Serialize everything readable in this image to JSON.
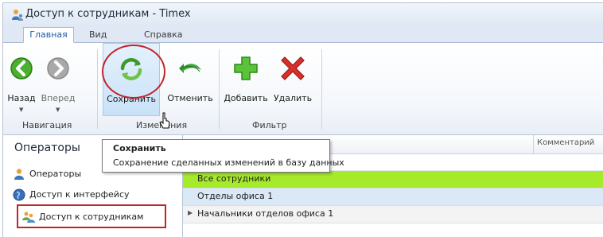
{
  "window": {
    "title": "Доступ к сотрудникам - Timex"
  },
  "ribbon_tabs": [
    {
      "label": "Главная",
      "active": true
    },
    {
      "label": "Вид",
      "active": false
    },
    {
      "label": "Справка",
      "active": false
    }
  ],
  "ribbon": {
    "navigation": {
      "group_label": "Навигация",
      "back_label": "Назад",
      "forward_label": "Вперед"
    },
    "changes": {
      "group_label": "Изменения",
      "save_label": "Сохранить",
      "cancel_label": "Отменить"
    },
    "filter": {
      "group_label": "Фильтр",
      "add_label": "Добавить",
      "delete_label": "Удалить"
    }
  },
  "tooltip": {
    "title": "Сохранить",
    "body": "Сохранение сделанных изменений в базу данных"
  },
  "sidebar": {
    "title": "Операторы",
    "items": [
      {
        "label": "Операторы",
        "icon": "user-icon"
      },
      {
        "label": "Доступ к интерфейсу",
        "icon": "globe-icon"
      },
      {
        "label": "Доступ к сотрудникам",
        "icon": "users-icon",
        "active": true
      }
    ]
  },
  "grid": {
    "columns": [
      "Комментарий"
    ],
    "rows": [
      {
        "name": "Все сотрудники"
      },
      {
        "name": "Отделы офиса 1"
      },
      {
        "name": "Начальники отделов офиса 1"
      }
    ]
  },
  "colors": {
    "accent": "#1c5da8",
    "highlight_red": "#c2242a",
    "row_selected": "#a6ea2c",
    "row_alt": "#dbe9f6"
  }
}
